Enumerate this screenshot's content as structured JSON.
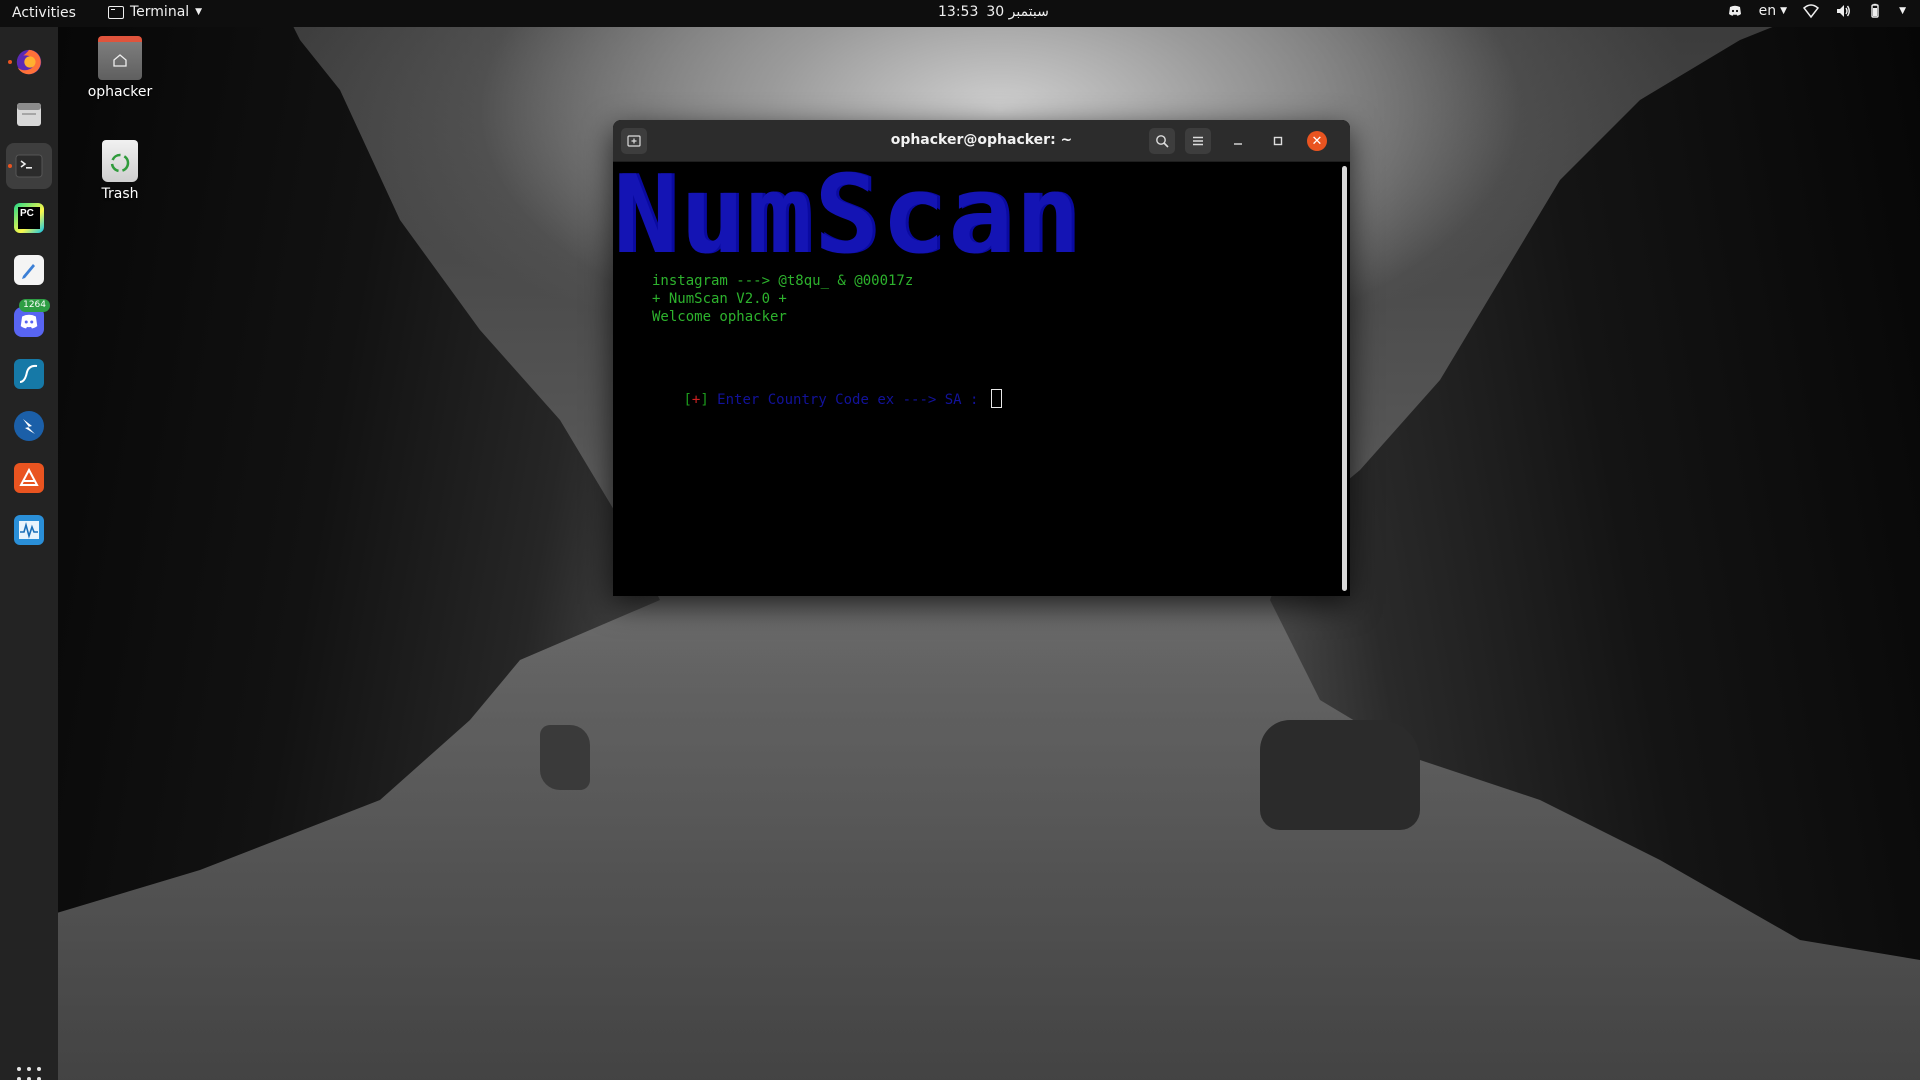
{
  "topbar": {
    "activities": "Activities",
    "app_name": "Terminal",
    "clock_date": "سبتمبر 30",
    "clock_time": "13:53",
    "language": "en"
  },
  "dock": {
    "badge_count": "1264",
    "items": [
      {
        "name": "Firefox",
        "icon": "firefox-icon"
      },
      {
        "name": "Files",
        "icon": "files-icon"
      },
      {
        "name": "Terminal",
        "icon": "terminal-icon"
      },
      {
        "name": "PyCharm",
        "icon": "pycharm-icon"
      },
      {
        "name": "Text Editor",
        "icon": "text-editor-icon"
      },
      {
        "name": "Discord",
        "icon": "discord-icon"
      },
      {
        "name": "Wireshark",
        "icon": "wireshark-icon"
      },
      {
        "name": "Zap",
        "icon": "zap-icon"
      },
      {
        "name": "Ubuntu Software",
        "icon": "software-store-icon"
      },
      {
        "name": "System Monitor",
        "icon": "system-monitor-icon"
      }
    ]
  },
  "desktop": {
    "home_label": "ophacker",
    "trash_label": "Trash"
  },
  "terminal": {
    "title": "ophacker@ophacker: ~",
    "banner": "NumScan",
    "lines": [
      "instagram ---> @t8qu_ & @00017z",
      "+ NumScan V2.0 +",
      "Welcome ophacker"
    ],
    "prompt_open": "[",
    "prompt_plus": "+",
    "prompt_close": "]",
    "prompt_text": " Enter Country Code ex ---> SA : "
  },
  "colors": {
    "accent": "#e95420",
    "banner_blue": "#1414b4",
    "terminal_green": "#2db22d"
  }
}
